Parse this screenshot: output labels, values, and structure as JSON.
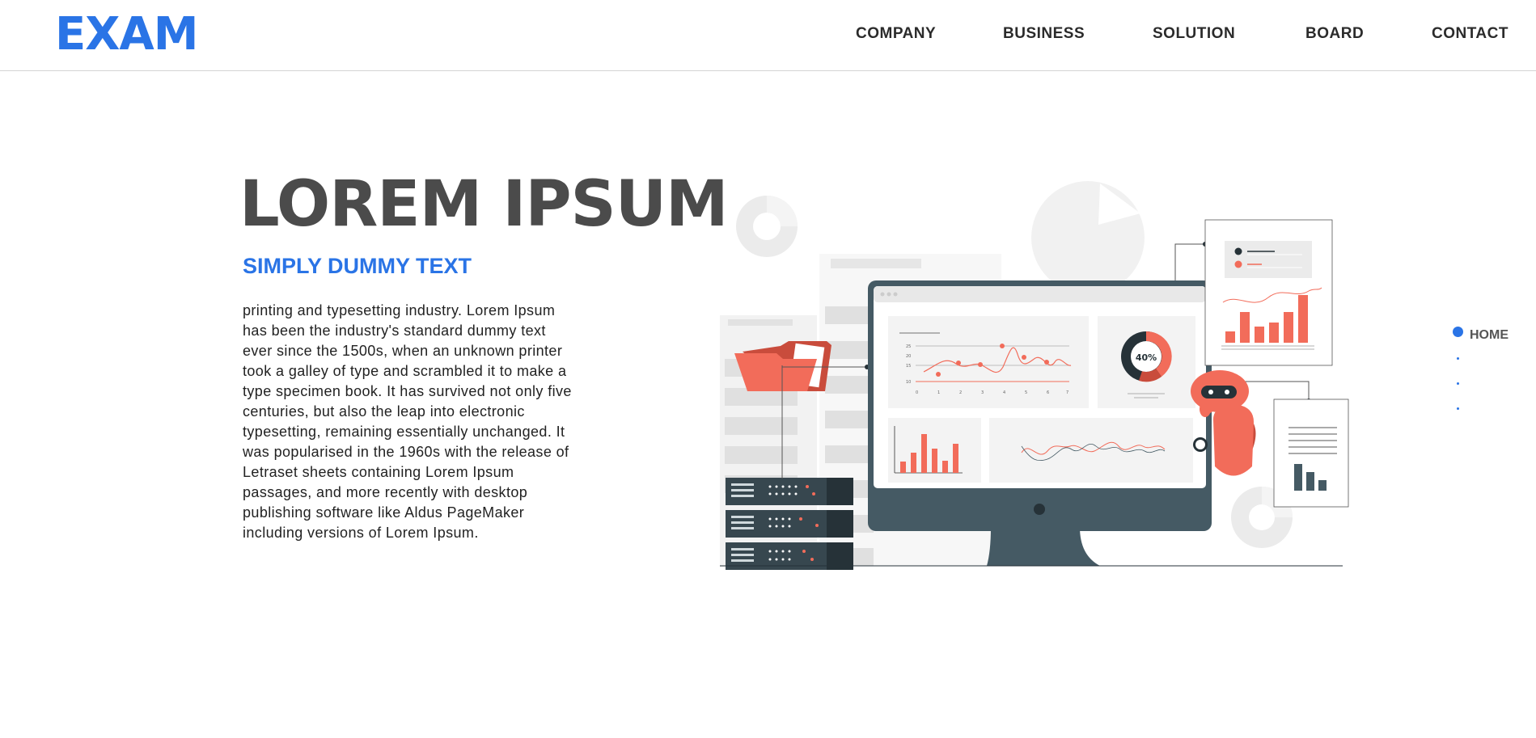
{
  "header": {
    "logo": "EXAM",
    "nav": [
      "COMPANY",
      "BUSINESS",
      "SOLUTION",
      "BOARD",
      "CONTACT"
    ]
  },
  "hero": {
    "title": "LOREM IPSUM",
    "subtitle": "SIMPLY DUMMY TEXT",
    "body": "printing and typesetting industry. Lorem Ipsum has been the industry's standard dummy text ever since the 1500s, when an unknown printer took a galley of type and scrambled it to make a type specimen book. It has survived not only five centuries, but also the leap into electronic typesetting, remaining essentially unchanged. It was popularised in the 1960s with the release of Letraset sheets containing Lorem Ipsum passages, and more recently with desktop publishing software like Aldus PageMaker including versions of Lorem Ipsum."
  },
  "illustration": {
    "donut_label": "40%",
    "chart_axis_x": [
      "0",
      "1",
      "2",
      "3",
      "4",
      "5",
      "6",
      "7"
    ],
    "chart_axis_y": [
      "25",
      "20",
      "15",
      "10"
    ]
  },
  "section_nav": {
    "active_label": "HOME",
    "count": 4
  },
  "colors": {
    "brand": "#2a74e6",
    "accent": "#f26c5a",
    "dark": "#455a64"
  }
}
